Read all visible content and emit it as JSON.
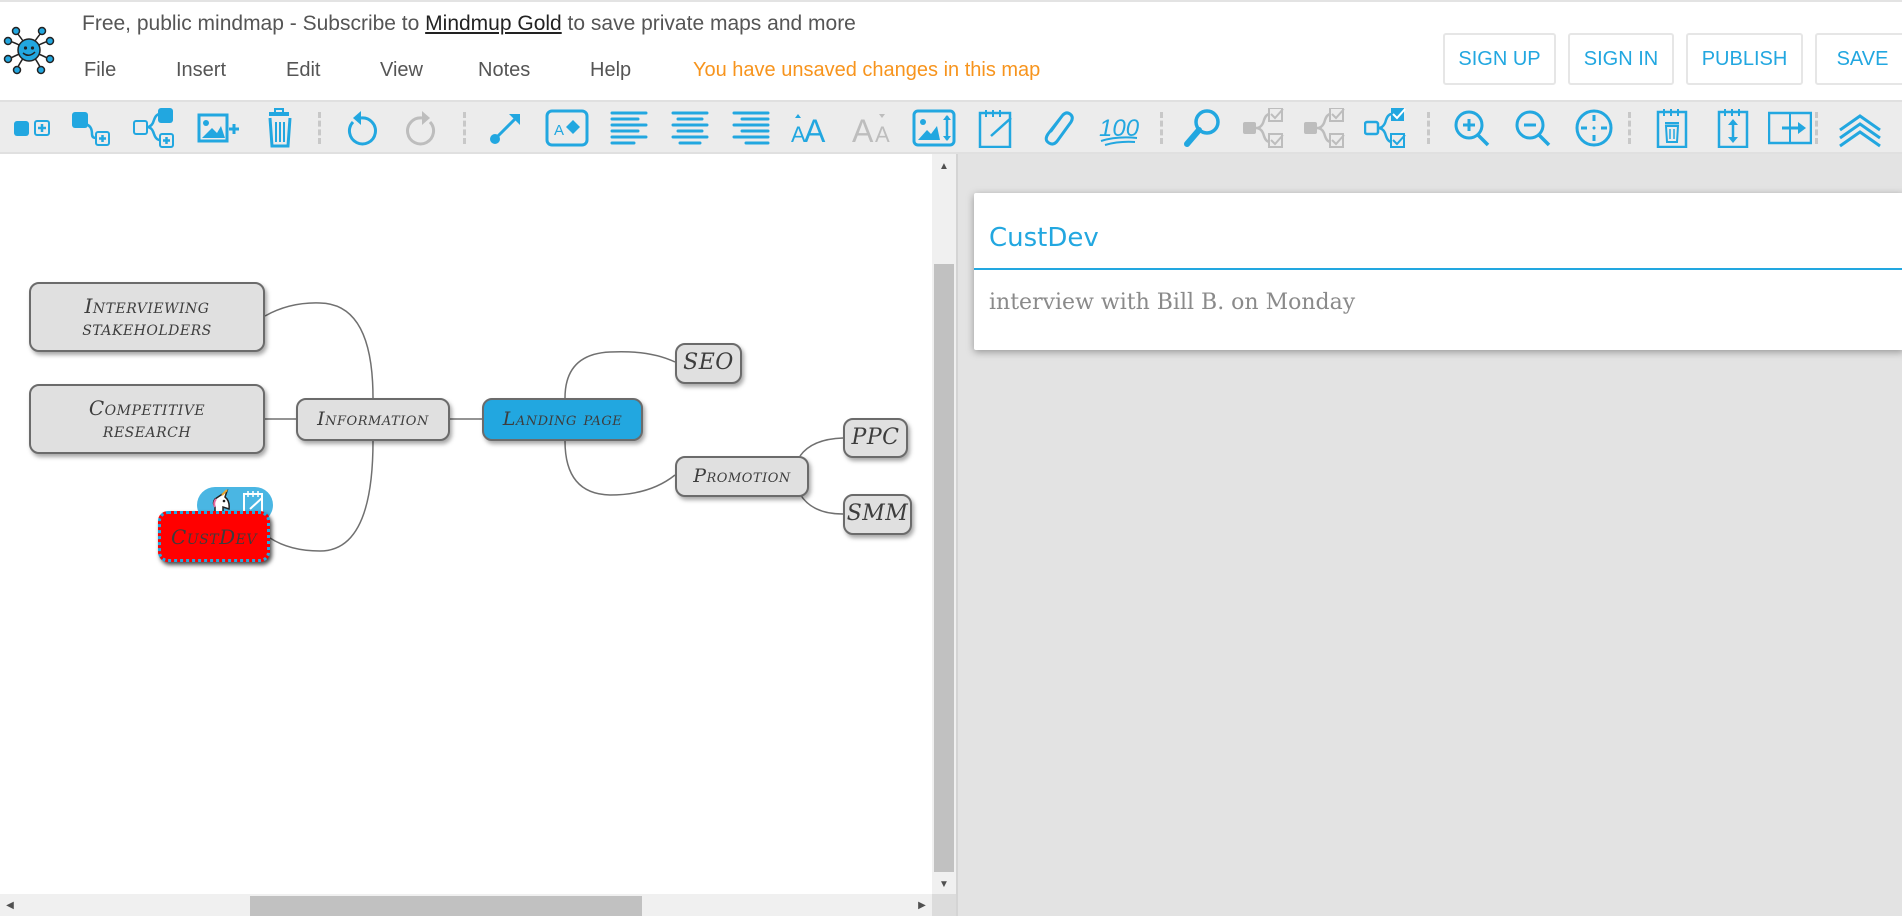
{
  "header": {
    "promo_prefix": "Free, public mindmap - Subscribe to ",
    "promo_link": "Mindmup Gold",
    "promo_suffix": " to save private maps and more",
    "menu": [
      {
        "label": "File"
      },
      {
        "label": "Insert"
      },
      {
        "label": "Edit"
      },
      {
        "label": "View"
      },
      {
        "label": "Notes"
      },
      {
        "label": "Help"
      }
    ],
    "unsaved_message": "You have unsaved changes in this map",
    "buttons": {
      "sign_up": "SIGN UP",
      "sign_in": "SIGN IN",
      "publish": "PUBLISH",
      "save": "SAVE"
    }
  },
  "toolbar": {
    "icons": [
      {
        "name": "add-sibling-icon",
        "enabled": true
      },
      {
        "name": "add-child-icon",
        "enabled": true
      },
      {
        "name": "insert-parent-icon",
        "enabled": true
      },
      {
        "name": "add-image-icon",
        "enabled": true
      },
      {
        "name": "delete-icon",
        "enabled": true
      },
      {
        "name": "undo-icon",
        "enabled": true
      },
      {
        "name": "redo-icon",
        "enabled": false
      },
      {
        "name": "add-link-icon",
        "enabled": true
      },
      {
        "name": "node-style-icon",
        "enabled": true
      },
      {
        "name": "align-left-icon",
        "enabled": true
      },
      {
        "name": "align-center-icon",
        "enabled": true
      },
      {
        "name": "align-right-icon",
        "enabled": true
      },
      {
        "name": "increase-font-icon",
        "enabled": true
      },
      {
        "name": "decrease-font-icon",
        "enabled": false
      },
      {
        "name": "image-size-icon",
        "enabled": true
      },
      {
        "name": "edit-note-icon",
        "enabled": true
      },
      {
        "name": "attachment-icon",
        "enabled": true
      },
      {
        "name": "emoji-100-icon",
        "enabled": true
      },
      {
        "name": "search-icon",
        "enabled": true
      },
      {
        "name": "progress-checked-icon",
        "enabled": false
      },
      {
        "name": "progress-unchecked-icon",
        "enabled": false
      },
      {
        "name": "progress-tracking-icon",
        "enabled": true
      },
      {
        "name": "zoom-in-icon",
        "enabled": true
      },
      {
        "name": "zoom-out-icon",
        "enabled": true
      },
      {
        "name": "reset-view-icon",
        "enabled": true
      },
      {
        "name": "delete-note-icon",
        "enabled": true
      },
      {
        "name": "resize-note-icon",
        "enabled": true
      },
      {
        "name": "split-view-icon",
        "enabled": true
      },
      {
        "name": "collapse-toolbar-icon",
        "enabled": true
      }
    ],
    "colors": {
      "active": "#22a7e0",
      "disabled": "#bdbdbd"
    }
  },
  "map": {
    "nodes": [
      {
        "id": "interviewing",
        "label": "Interviewing stakeholders",
        "style": "normal"
      },
      {
        "id": "competitive",
        "label": "Competitive research",
        "style": "normal"
      },
      {
        "id": "information",
        "label": "Information",
        "style": "normal"
      },
      {
        "id": "landing",
        "label": "Landing page",
        "style": "root"
      },
      {
        "id": "seo",
        "label": "SEO",
        "style": "normal"
      },
      {
        "id": "promotion",
        "label": "Promotion",
        "style": "normal"
      },
      {
        "id": "ppc",
        "label": "PPC",
        "style": "normal"
      },
      {
        "id": "smm",
        "label": "SMM",
        "style": "normal"
      },
      {
        "id": "custdev",
        "label": "CustDev",
        "style": "selected",
        "icon": "unicorn",
        "has_note": true
      }
    ],
    "links": [
      [
        "information",
        "interviewing"
      ],
      [
        "information",
        "competitive"
      ],
      [
        "information",
        "custdev"
      ],
      [
        "landing",
        "information"
      ],
      [
        "landing",
        "seo"
      ],
      [
        "landing",
        "promotion"
      ],
      [
        "promotion",
        "ppc"
      ],
      [
        "promotion",
        "smm"
      ]
    ],
    "colors": {
      "root": "#22a7e0",
      "node": "#e0e0e0",
      "selected": "#ff0000",
      "selection_border": "#22a7e0"
    }
  },
  "note": {
    "title": "CustDev",
    "body": "interview with Bill B. on Monday"
  }
}
